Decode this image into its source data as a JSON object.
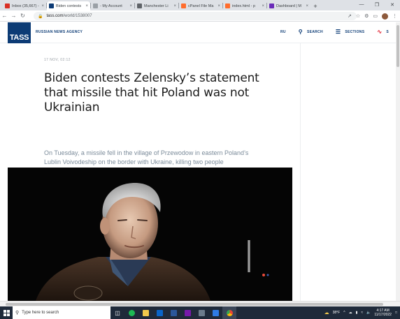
{
  "browser": {
    "tabs": [
      {
        "label": "Inbox (35,667) -",
        "favicon_color": "#d93025"
      },
      {
        "label": "Biden contests",
        "favicon_color": "#0c3b75",
        "active": true
      },
      {
        "label": "- My Account",
        "favicon_color": "#9aa0a6"
      },
      {
        "label": "Manchester Li",
        "favicon_color": "#5f6368"
      },
      {
        "label": "cPanel File Ma",
        "favicon_color": "#ff6c2c"
      },
      {
        "label": "index.html - p",
        "favicon_color": "#ff6c2c"
      },
      {
        "label": "Dashboard | M",
        "favicon_color": "#6a2bb8"
      }
    ],
    "url_domain": "tass.com",
    "url_path": "/world/1538007"
  },
  "site": {
    "logo": "TASS",
    "agency": "RUSSIAN NEWS AGENCY",
    "nav": {
      "lang": "RU",
      "search": "SEARCH",
      "sections": "SECTIONS",
      "live": "S"
    }
  },
  "article": {
    "date": "17 NOV, 02:12",
    "headline": "Biden contests Zelensky’s statement that missile that hit Poland was not Ukrainian",
    "lead": "On Tuesday, a missile fell in the village of Przewodow in eastern Poland’s Lublin Voivodeship on the border with Ukraine, killing two people"
  },
  "taskbar": {
    "search_placeholder": "Type here to search",
    "temperature": "38°F",
    "time": "4:17 AM",
    "date": "11/17/2022"
  },
  "colors": {
    "brand": "#0c3b75",
    "live": "#e22838",
    "taskbar": "#1f2a3a"
  }
}
